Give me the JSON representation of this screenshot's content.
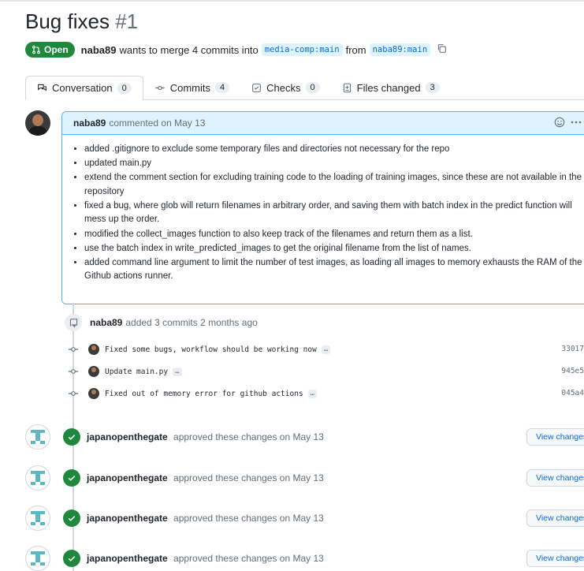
{
  "pr": {
    "title": "Bug fixes",
    "number": "#1",
    "state": "Open",
    "author": "naba89",
    "merge_text": "wants to merge 4 commits into",
    "base_branch": "media-comp:main",
    "from_text": "from",
    "head_branch": "naba89:main"
  },
  "tabs": [
    {
      "label": "Conversation",
      "count": "0",
      "icon": "conversation-icon"
    },
    {
      "label": "Commits",
      "count": "4",
      "icon": "commit-icon"
    },
    {
      "label": "Checks",
      "count": "0",
      "icon": "checks-icon"
    },
    {
      "label": "Files changed",
      "count": "3",
      "icon": "file-diff-icon"
    }
  ],
  "comment": {
    "author": "naba89",
    "action": "commented on May 13",
    "items": [
      "added .gitignore to exclude some temporary files and directories not necessary for the repo",
      "updated main.py",
      "extend the comment section for excluding training code to the loading of training images, since these are not available in the repository",
      "fixed a bug, where glob will return filenames in arbitrary order, and saving them with batch index in the predict function will mess up the order.",
      "modified the collect_images function to also keep track of the filenames and return them as a list.",
      "use the batch index in write_predicted_images to get the original filename from the list of names.",
      "added command line argument to limit the number of test images, as loading all images to memory exhausts the RAM of the Github actions runner."
    ]
  },
  "commits_event": {
    "author": "naba89",
    "text": "added 3 commits 2 months ago",
    "commits": [
      {
        "message": "Fixed some bugs, workflow should be working now",
        "sha": "33017"
      },
      {
        "message": "Update main.py",
        "sha": "945e5"
      },
      {
        "message": "Fixed out of memory error for github actions",
        "sha": "045a4"
      }
    ]
  },
  "reviews": [
    {
      "author": "japanopenthegate",
      "text": "approved these changes on May 13",
      "button": "View changes"
    },
    {
      "author": "japanopenthegate",
      "text": "approved these changes on May 13",
      "button": "View changes"
    },
    {
      "author": "japanopenthegate",
      "text": "approved these changes on May 13",
      "button": "View changes"
    },
    {
      "author": "japanopenthegate",
      "text": "approved these changes on May 13",
      "button": "View changes"
    }
  ],
  "colors": {
    "open_green": "#1f883d",
    "link_blue": "#0969da",
    "header_blue": "#ddf4ff",
    "identicon": "#5cb8c6"
  }
}
